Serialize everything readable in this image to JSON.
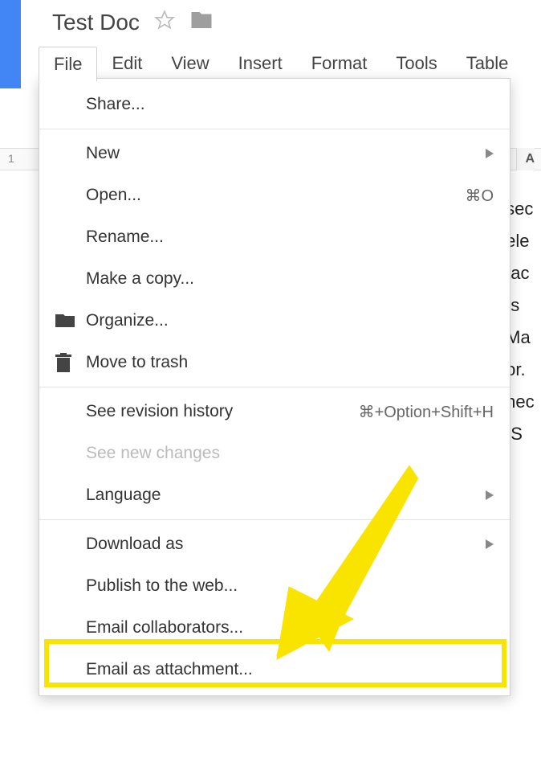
{
  "document": {
    "title": "Test Doc"
  },
  "menubar": {
    "file": "File",
    "edit": "Edit",
    "view": "View",
    "insert": "Insert",
    "format": "Format",
    "tools": "Tools",
    "table": "Table"
  },
  "ruler": {
    "mark1": "1",
    "right_label": "A"
  },
  "dropdown": {
    "share": "Share...",
    "new": "New",
    "open": "Open...",
    "open_shortcut": "⌘O",
    "rename": "Rename...",
    "make_copy": "Make a copy...",
    "organize": "Organize...",
    "move_to_trash": "Move to trash",
    "revision_history": "See revision history",
    "revision_shortcut": "⌘+Option+Shift+H",
    "see_new_changes": "See new changes",
    "language": "Language",
    "download_as": "Download as",
    "publish_web": "Publish to the web...",
    "email_collaborators": "Email collaborators...",
    "email_attachment": "Email as attachment..."
  },
  "doc_body": {
    "snippet": " sec\n ele\n tac\nus\n Ma\ntor.\n nec\n. S"
  }
}
